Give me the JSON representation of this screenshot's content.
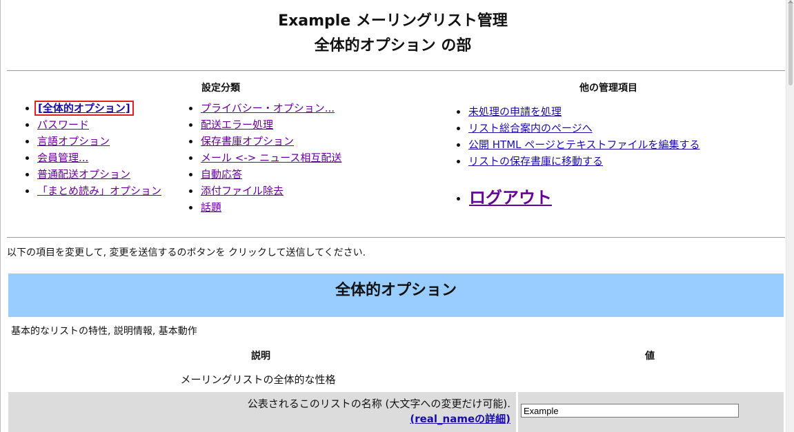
{
  "header": {
    "title_line1": "Example メーリングリスト管理",
    "title_line2": "全体的オプション の部"
  },
  "settings_nav": {
    "heading": "設定分類",
    "col1": [
      {
        "label": "[全体的オプション]",
        "current": true
      },
      {
        "label": "パスワード"
      },
      {
        "label": "言語オプション"
      },
      {
        "label": "会員管理..."
      },
      {
        "label": "普通配送オプション"
      },
      {
        "label": "「まとめ読み」オプション"
      }
    ],
    "col2": [
      {
        "label": "プライバシー・オプション..."
      },
      {
        "label": "配送エラー処理"
      },
      {
        "label": "保存書庫オプション"
      },
      {
        "label": "メール <-> ニュース相互配送"
      },
      {
        "label": "自動応答"
      },
      {
        "label": "添付ファイル除去"
      },
      {
        "label": "話題"
      }
    ]
  },
  "other_admin": {
    "heading": "他の管理項目",
    "items": [
      {
        "label": "未処理の申請を処理"
      },
      {
        "label": "リスト総合案内のページへ"
      },
      {
        "label": "公開 HTML ページとテキストファイルを編集する"
      },
      {
        "label": "リストの保存書庫に移動する"
      }
    ],
    "logout": "ログアウト"
  },
  "instructions": "以下の項目を変更して, 変更を送信するのボタンを クリックして送信してください.",
  "section": {
    "title": "全体的オプション",
    "description": "基本的なリストの特性, 説明情報, 基本動作",
    "col_description": "説明",
    "col_value": "値",
    "group_label": "メーリングリストの全体的な性格"
  },
  "rows": [
    {
      "label": "公表されるこのリストの名称 (大文字への変更だけ可能).",
      "detail_prefix": "(",
      "detail_name": "real_name",
      "detail_suffix": "の詳細)",
      "value": "Example"
    }
  ],
  "colors": {
    "section_band": "#99ccff",
    "row_bg": "#dcdcdc",
    "link": "#1a0dab",
    "visited_link": "#660099",
    "highlight_border": "#e02020"
  }
}
